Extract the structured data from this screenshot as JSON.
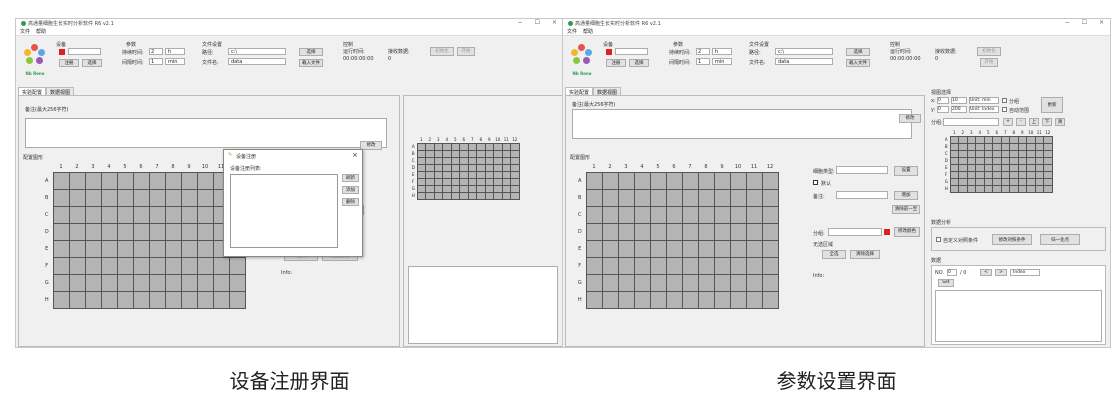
{
  "left": {
    "title": "高通量细胞生长实时分析软件 R6 v2.1",
    "window_buttons": [
      "−",
      "☐",
      "×"
    ],
    "menu": [
      "文件",
      "帮助"
    ],
    "group_device": "设备",
    "btn_register": "注册",
    "btn_select": "选择",
    "group_params": "参数",
    "lbl_duration": "持续时间:",
    "val_duration": "2",
    "unit_duration": "h",
    "lbl_interval": "间隔时间:",
    "val_interval": "1",
    "unit_interval": "min",
    "group_file": "文件设置",
    "lbl_path": "路径:",
    "val_path": "c:\\",
    "lbl_filename": "文件名:",
    "val_filename": "data",
    "btn_choose": "选择",
    "btn_load": "载入文件",
    "group_control": "控制",
    "lbl_elapsed": "运行时间:",
    "val_elapsed": "00:00:00:00",
    "lbl_received": "接收数据:",
    "val_received": "0",
    "btn_init": "初始化",
    "btn_start": "开始",
    "tab1": "实验配置",
    "tab2": "数据视图",
    "memo_label": "备注(最大256字符)",
    "btn_modify": "修改",
    "grid_label": "配置图形",
    "cols": [
      "1",
      "2",
      "3",
      "4",
      "5",
      "6",
      "7",
      "8",
      "9",
      "10",
      "11",
      "12"
    ],
    "rows": [
      "A",
      "B",
      "C",
      "D",
      "E",
      "F",
      "G",
      "H"
    ],
    "btn_setting": "设置",
    "btn_confirm": "确认",
    "btn_clearall": "清除所有",
    "btn_fill": "增加",
    "btn_clear_one": "清除前一至",
    "btn_modify_color": "修改颜色",
    "info": "Info:",
    "dialog_title": "设备注册",
    "dialog_list_label": "设备注册列表:",
    "dialog_refresh": "刷新",
    "dialog_add": "添加",
    "dialog_delete": "删除",
    "caption": "设备注册界面"
  },
  "right": {
    "title": "高通量细胞生长实时分析软件 R6 v2.1",
    "window_buttons": [
      "−",
      "☐",
      "×"
    ],
    "menu": [
      "文件",
      "帮助"
    ],
    "group_device": "设备",
    "btn_register": "注册",
    "btn_select": "选择",
    "group_params": "参数",
    "lbl_duration": "持续时间:",
    "val_duration": "2",
    "unit_duration": "h",
    "lbl_interval": "间隔时间:",
    "val_interval": "1",
    "unit_interval": "min",
    "group_file": "文件设置",
    "lbl_path": "路径:",
    "val_path": "c:\\",
    "lbl_filename": "文件名:",
    "val_filename": "data",
    "btn_choose": "选择",
    "btn_load": "载入文件",
    "group_control": "控制",
    "lbl_elapsed": "运行时间:",
    "val_elapsed": "00:00:00:00",
    "lbl_received": "接收数据:",
    "val_received": "0",
    "btn_init": "初始化",
    "btn_start": "开始",
    "tab1": "实验配置",
    "tab2": "数据视图",
    "memo_label": "备注(最大256字符)",
    "btn_modify": "修改",
    "grid_label": "配置图形",
    "cols": [
      "1",
      "2",
      "3",
      "4",
      "5",
      "6",
      "7",
      "8",
      "9",
      "10",
      "11",
      "12"
    ],
    "rows": [
      "A",
      "B",
      "C",
      "D",
      "E",
      "F",
      "G",
      "H"
    ],
    "lbl_cell_type": "细胞类型:",
    "btn_setting": "设置",
    "chk_default": "默认",
    "lbl_note": "备注:",
    "btn_add": "增加",
    "btn_clear_one": "清除前一至",
    "lbl_group": "分组:",
    "btn_modify_color": "修改颜色",
    "lbl_selection": "无选区域",
    "btn_select_all": "全选",
    "btn_clear_sel": "清除选择",
    "info": "Info:",
    "view_title": "视图选择",
    "lbl_x": "x:",
    "val_x0": "0",
    "val_x1": "10",
    "unit_x": "Unit: min",
    "chk_group": "分组",
    "lbl_y": "y:",
    "val_y0": "0",
    "val_y1": "200",
    "unit_y": "Unit: Index",
    "chk_auto": "自动范围",
    "btn_update": "更新",
    "lbl_sgroup": "分组:",
    "tool_buttons": [
      "+",
      "-",
      "上",
      "下",
      "清"
    ],
    "analysis_title": "数据分析",
    "chk_custom": "自定义对照条件",
    "btn_cond": "修改对照条件",
    "btn_norm": "归一化点",
    "data_title": "数据",
    "lbl_no": "NO.",
    "val_no": "0",
    "val_total": "/ 0",
    "nav_prev": "<",
    "nav_next": ">",
    "index_sel": "Index",
    "btn_set": "Set",
    "caption": "参数设置界面"
  }
}
